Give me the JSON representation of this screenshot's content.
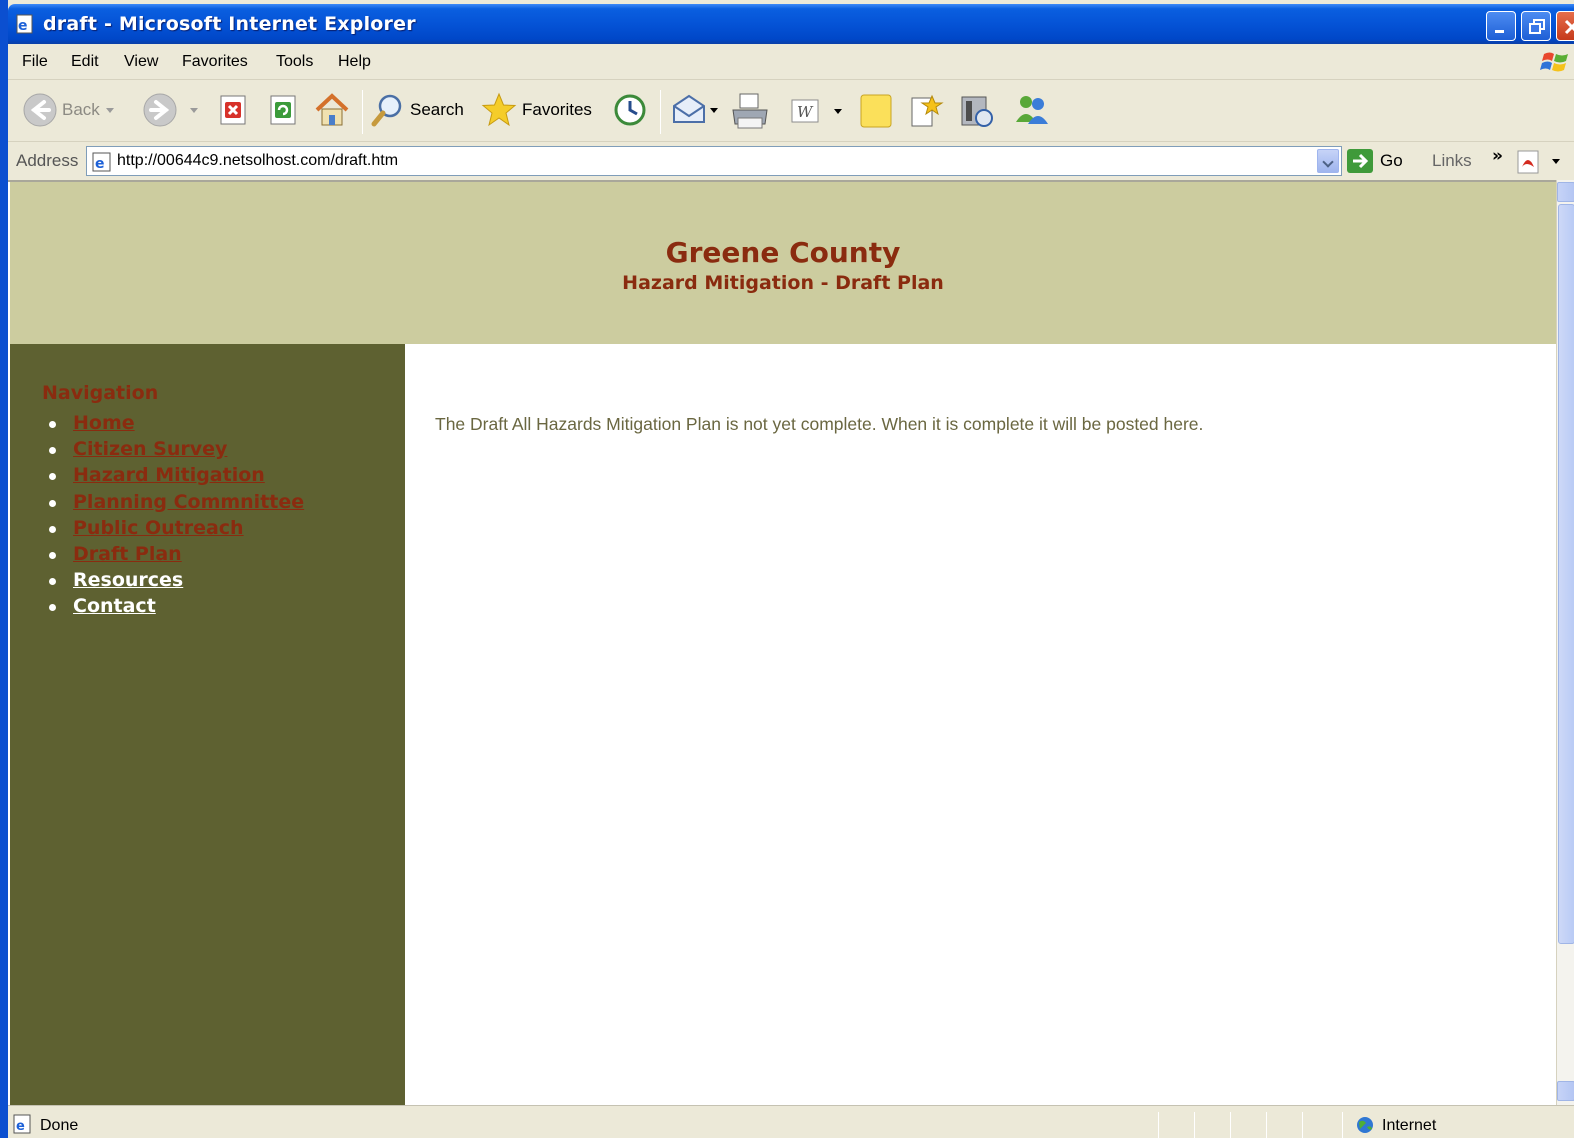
{
  "window": {
    "title": "draft - Microsoft Internet Explorer"
  },
  "menu": [
    "File",
    "Edit",
    "View",
    "Favorites",
    "Tools",
    "Help"
  ],
  "toolbar": {
    "back_label": "Back",
    "search_label": "Search",
    "favorites_label": "Favorites"
  },
  "address": {
    "label": "Address",
    "url": "http://00644c9.netsolhost.com/draft.htm",
    "go_label": "Go",
    "links_label": "Links"
  },
  "page": {
    "title": "Greene County",
    "subtitle": "Hazard Mitigation - Draft Plan",
    "nav_heading": "Navigation",
    "nav_items": [
      {
        "label": "Home",
        "color": "#8a2b0f"
      },
      {
        "label": "Citizen Survey",
        "color": "#8a2b0f"
      },
      {
        "label": "Hazard Mitigation",
        "color": "#8a2b0f"
      },
      {
        "label": "Planning Commnittee",
        "color": "#8a2b0f"
      },
      {
        "label": "Public Outreach",
        "color": "#8a2b0f"
      },
      {
        "label": "Draft Plan",
        "color": "#8a2b0f"
      },
      {
        "label": "Resources",
        "color": "#ffffff"
      },
      {
        "label": "Contact",
        "color": "#ffffff"
      }
    ],
    "body_text": "The Draft All Hazards Mitigation Plan is not yet complete. When it is complete it will be posted here."
  },
  "status": {
    "text": "Done",
    "zone": "Internet"
  },
  "colors": {
    "header_bg": "#cccc9f",
    "sidebar_bg": "#5e6131",
    "accent": "#8a2b0f"
  }
}
